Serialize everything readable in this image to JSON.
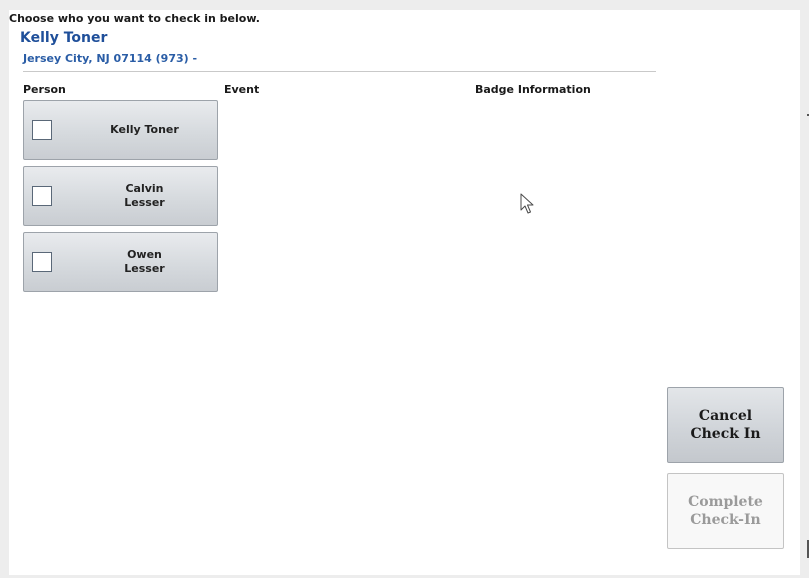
{
  "instructions": "Choose who you want to check in below.",
  "family": {
    "name": "Kelly Toner",
    "address": "Jersey City, NJ 07114 (973)   -"
  },
  "columns": {
    "person": "Person",
    "event": "Event",
    "badge": "Badge Information"
  },
  "people": [
    {
      "name": "Kelly Toner",
      "checked": false
    },
    {
      "name": "Calvin\nLesser",
      "checked": false
    },
    {
      "name": "Owen\nLesser",
      "checked": false
    }
  ],
  "actions": {
    "cancel": "Cancel\nCheck In",
    "complete": "Complete\nCheck-In",
    "complete_enabled": false
  },
  "icons": {
    "cursor": "mouse-pointer-icon"
  },
  "colors": {
    "accent_blue": "#1f4f9a",
    "disabled_text": "#9a9a9a"
  }
}
